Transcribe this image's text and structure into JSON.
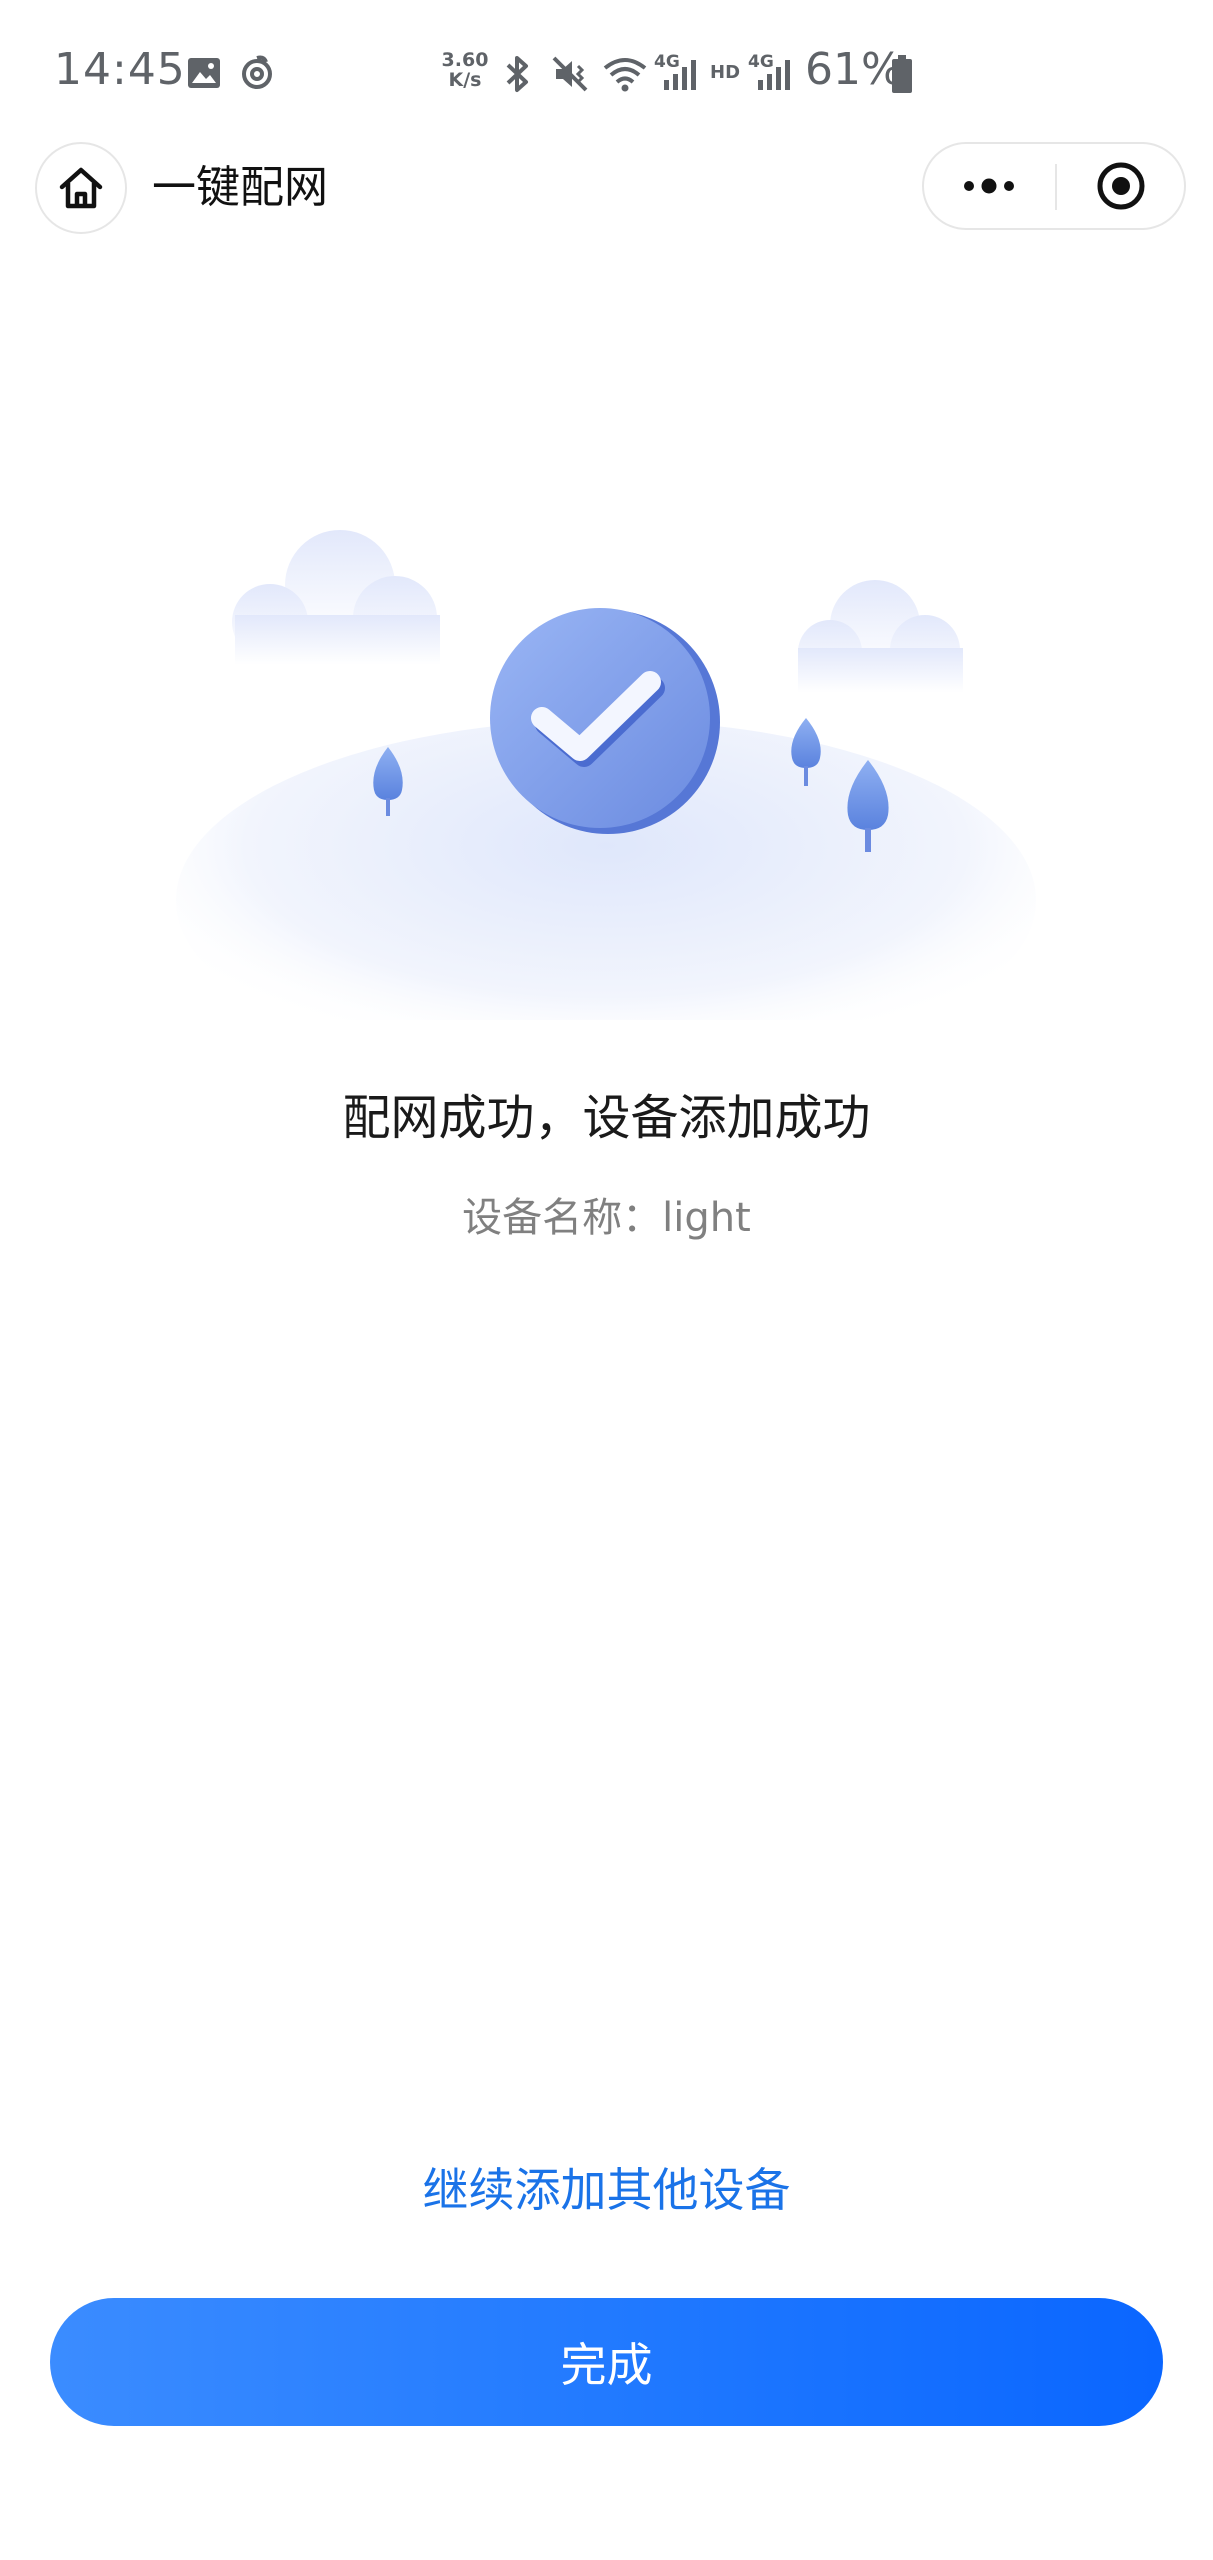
{
  "status_bar": {
    "time": "14:45",
    "net_speed_value": "3.60",
    "net_speed_unit": "K/s",
    "network_label_1": "4G",
    "hd_label": "HD",
    "network_label_2": "4G",
    "battery": "61%"
  },
  "nav": {
    "title": "一键配网"
  },
  "result": {
    "title": "配网成功，设备添加成功",
    "device_name": "设备名称：light"
  },
  "actions": {
    "continue_label": "继续添加其他设备",
    "done_label": "完成"
  },
  "colors": {
    "accent": "#1a73e8",
    "button_start": "#3b8cff",
    "button_end": "#0a66ff",
    "check_circle": "#7b9ff0"
  }
}
